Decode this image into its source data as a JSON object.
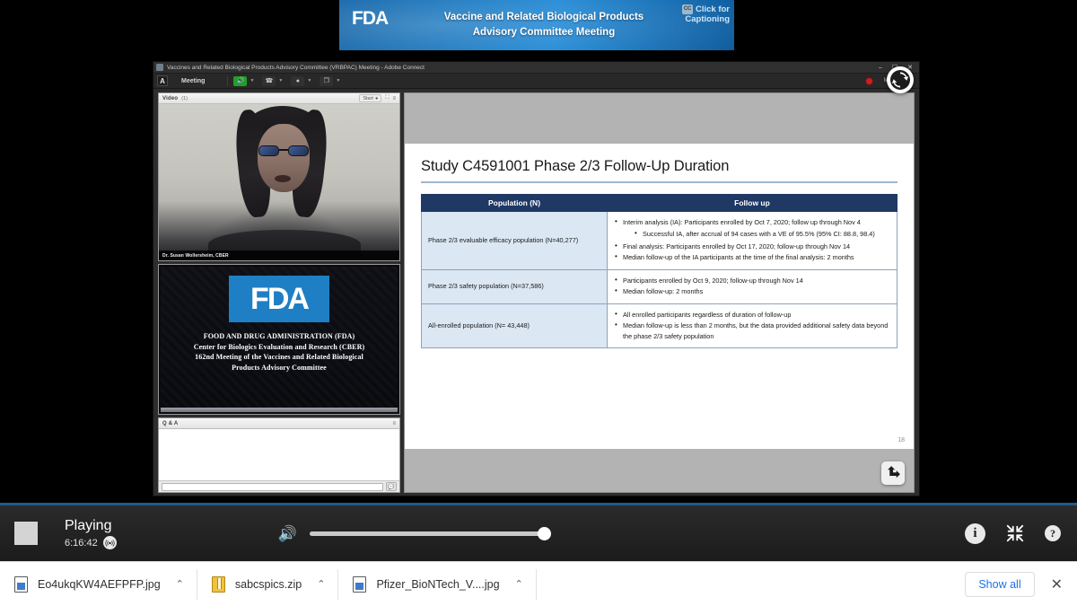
{
  "banner": {
    "logo": "FDA",
    "title_line1": "Vaccine and Related Biological Products",
    "title_line2": "Advisory Committee Meeting",
    "cc_badge": "CC",
    "cc_line1": "Click for",
    "cc_line2": "Captioning",
    "accent": "#1273bd"
  },
  "connect": {
    "window_title": "Vaccines and Related Biological Products Advisory Committee (VRBPAC) Meeting - Adobe Connect",
    "window_buttons": {
      "minimize": "–",
      "maximize": "⬜",
      "close": "✕"
    },
    "adobe_logo": "A",
    "menu_label": "Meeting",
    "toolbar_tools": [
      {
        "name": "speaker-tool",
        "glyph": "🔊",
        "state": "active"
      },
      {
        "name": "phone-tool",
        "glyph": "☎",
        "state": "idle"
      },
      {
        "name": "webcam-tool",
        "glyph": "●",
        "state": "idle"
      },
      {
        "name": "screen-share-tool",
        "glyph": "❐",
        "state": "idle"
      }
    ],
    "recording_label": "Meeting",
    "refresh_icon": "refresh-icon"
  },
  "video_pod": {
    "title": "Video",
    "count": "(1)",
    "start_label": "Start",
    "speaker_name": "Dr. Susan Wollersheim, CBER",
    "fullscreen_icon": "fullscreen-icon",
    "menu_icon": "pod-menu-icon"
  },
  "fda_slide_pod": {
    "logo": "FDA",
    "line1": "FOOD AND DRUG ADMINISTRATION (FDA)",
    "line2": "Center for Biologics Evaluation and Research (CBER)",
    "line3": "162nd Meeting of the Vaccines and Related Biological",
    "line4": "Products Advisory Committee"
  },
  "qa_pod": {
    "title": "Q & A",
    "menu_icon": "pod-menu-icon",
    "input_value": "",
    "send_icon": "chat-send-icon"
  },
  "slide": {
    "title": "Study C4591001 Phase 2/3 Follow-Up Duration",
    "page_number": "18",
    "header_color": "#1f3864",
    "columns": [
      "Population (N)",
      "Follow up"
    ],
    "rows": [
      {
        "population": "Phase 2/3 evaluable efficacy population (N=40,277)",
        "bullets": [
          {
            "text": "Interim analysis (IA): Participants enrolled by Oct 7, 2020; follow up through Nov 4",
            "sub": [
              "Successful IA, after accrual of 94 cases with a VE of 95.5% (95% CI: 88.8, 98.4)"
            ]
          },
          {
            "text": "Final analysis: Participants enrolled by Oct 17, 2020; follow-up through Nov 14",
            "sub": []
          },
          {
            "text": "Median follow-up of the IA participants at the time of the final analysis: 2 months",
            "sub": []
          }
        ]
      },
      {
        "population": "Phase 2/3 safety population (N=37,586)",
        "bullets": [
          {
            "text": "Participants enrolled by Oct 9, 2020; follow-up through Nov 14",
            "sub": []
          },
          {
            "text": "Median follow-up: 2 months",
            "sub": []
          }
        ]
      },
      {
        "population": "All-enrolled population (N= 43,448)",
        "bullets": [
          {
            "text": "All enrolled participants regardless of duration of follow-up",
            "sub": []
          },
          {
            "text": "Median follow-up is less than 2 months, but the data provided additional safety data beyond the phase 2/3 safety population",
            "sub": []
          }
        ]
      }
    ],
    "cursor_icon": "pointer-cursor-icon"
  },
  "player": {
    "stop_icon": "stop-icon",
    "status": "Playing",
    "time": "6:16:42",
    "live_icon": "live-broadcast-icon",
    "volume_icon": "volume-icon",
    "volume_percent": 100,
    "info_icon": "info-icon",
    "collapse_icon": "exit-fullscreen-icon",
    "help_icon": "help-icon"
  },
  "downloads": {
    "items": [
      {
        "name": "Eo4ukqKW4AEFPFP.jpg",
        "type": "image",
        "caret": "ⱏ"
      },
      {
        "name": "sabcspics.zip",
        "type": "zip",
        "caret": "ⱏ"
      },
      {
        "name": "Pfizer_BioNTech_V....jpg",
        "type": "image",
        "caret": "ⱏ"
      }
    ],
    "show_all_label": "Show all",
    "close_icon": "close-icon",
    "link_color": "#1a73e8"
  }
}
